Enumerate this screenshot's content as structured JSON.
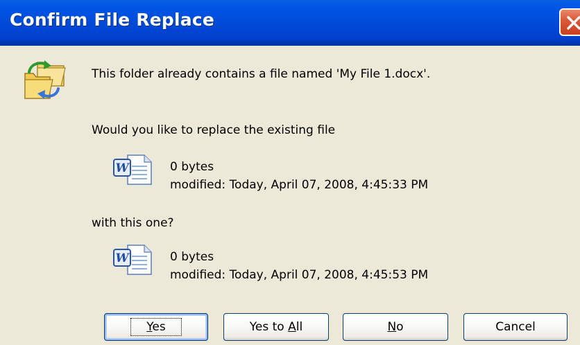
{
  "window": {
    "title": "Confirm File Replace"
  },
  "message": "This folder already contains a file named 'My File 1.docx'.",
  "question": "Would you like to replace the existing file",
  "existing_file": {
    "size": "0 bytes",
    "modified": "modified: Today, April 07, 2008, 4:45:33 PM",
    "icon": "word-document-icon"
  },
  "with_label": "with this one?",
  "new_file": {
    "size": "0 bytes",
    "modified": "modified: Today, April 07, 2008, 4:45:53 PM",
    "icon": "word-document-icon"
  },
  "buttons": {
    "yes_prefix": "",
    "yes_mnemonic": "Y",
    "yes_rest": "es",
    "yes_to_all_prefix": "Yes to ",
    "yes_to_all_mnemonic": "A",
    "yes_to_all_rest": "ll",
    "no_prefix": "",
    "no_mnemonic": "N",
    "no_rest": "o",
    "cancel": "Cancel"
  },
  "colors": {
    "titlebar": "#0049d6",
    "dialog_bg": "#ece9d8",
    "close_button": "#dc5a3a",
    "button_border": "#003c74"
  }
}
